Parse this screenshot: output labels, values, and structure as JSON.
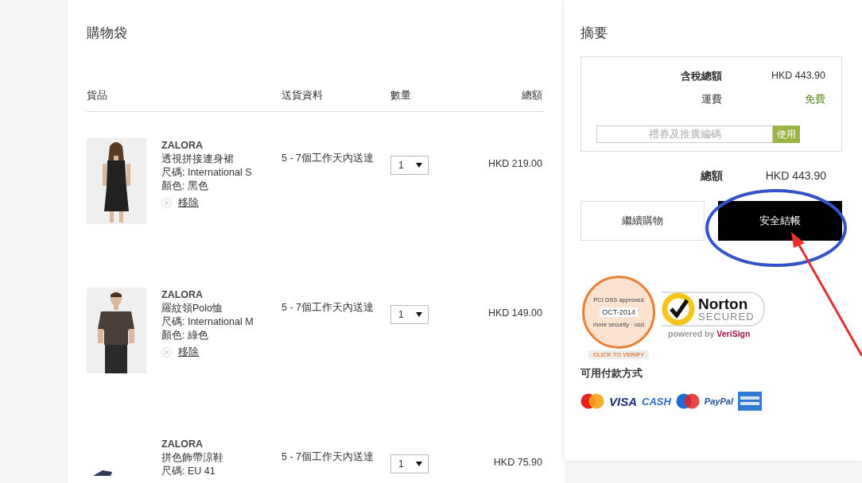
{
  "cart": {
    "title": "購物袋",
    "columns": [
      {
        "label": "貨品"
      },
      {
        "label": "送貨資料"
      },
      {
        "label": "數量"
      },
      {
        "label": "總額"
      }
    ],
    "items": [
      {
        "brand": "ZALORA",
        "name": "透視拼接連身裙",
        "size": "尺碼: International S",
        "colour_label": "顏色: 黑色",
        "remove": "移除",
        "delivery": "5 - 7個工作天內送達",
        "quantity": "1",
        "price": "HKD 219.00"
      },
      {
        "brand": "ZALORA",
        "name": "羅紋領Polo恤",
        "size": "尺碼: International M",
        "colour_label": "顏色: 綠色",
        "remove": "移除",
        "delivery": "5 - 7個工作天內送達",
        "quantity": "1",
        "price": "HKD 149.00"
      },
      {
        "brand": "ZALORA",
        "name": "拼色飾帶涼鞋",
        "size": "尺碼: EU 41",
        "delivery": "5 - 7個工作天內送達",
        "quantity": "1",
        "price": "HKD 75.90"
      }
    ]
  },
  "summary": {
    "title": "摘要",
    "rows": [
      {
        "label": "含稅總額",
        "value": "HKD 443.90",
        "kind": "amount"
      },
      {
        "label": "運費",
        "value": "免費",
        "kind": "free"
      }
    ],
    "coupon": {
      "placeholder": "禮券及推廣編碼",
      "button": "使用"
    },
    "total": {
      "label": "總額",
      "value": "HKD 443.90"
    },
    "buttons": [
      {
        "label": "繼續購物",
        "kind": "secondary"
      },
      {
        "label": "安全結帳",
        "kind": "primary"
      }
    ],
    "pci_badge": {
      "top": "PCI DSS approved",
      "date": "OCT-2014",
      "bottom": "more security · usd",
      "ribbon": "CLICK TO VERIFY"
    },
    "norton_badge": {
      "name": "Norton",
      "status": "SECURED",
      "powered": "powered by",
      "partner": "VeriSign"
    },
    "payment_title": "可用付款方式",
    "payment_methods": [
      {
        "kind": "mastercard"
      },
      {
        "kind": "visa",
        "label": "VISA"
      },
      {
        "kind": "cash",
        "label": "CASH"
      },
      {
        "kind": "maestro"
      },
      {
        "kind": "paypal",
        "label": "PayPal"
      },
      {
        "kind": "amex"
      }
    ]
  }
}
